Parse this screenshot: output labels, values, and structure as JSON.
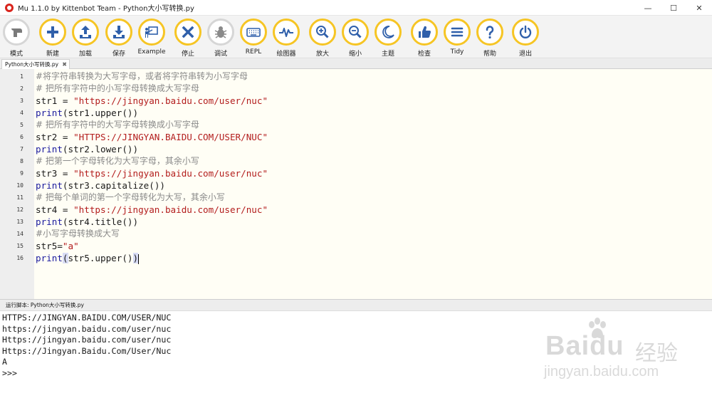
{
  "window": {
    "title": "Mu 1.1.0 by Kittenbot Team - Python大小写转换.py",
    "controls": {
      "minimize": "—",
      "maximize": "☐",
      "close": "✕"
    }
  },
  "toolbar": {
    "buttons": [
      {
        "label": "模式",
        "icon": "mode-icon"
      },
      {
        "label": "新建",
        "icon": "plus-icon"
      },
      {
        "label": "加载",
        "icon": "load-icon"
      },
      {
        "label": "保存",
        "icon": "save-icon"
      },
      {
        "label": "Example",
        "icon": "example-icon"
      },
      {
        "label": "停止",
        "icon": "stop-icon"
      },
      {
        "label": "调试",
        "icon": "bug-icon"
      },
      {
        "label": "REPL",
        "icon": "keyboard-icon"
      },
      {
        "label": "绘图器",
        "icon": "plotter-icon"
      },
      {
        "label": "放大",
        "icon": "zoom-in-icon"
      },
      {
        "label": "缩小",
        "icon": "zoom-out-icon"
      },
      {
        "label": "主题",
        "icon": "moon-icon"
      },
      {
        "label": "检查",
        "icon": "thumbs-up-icon"
      },
      {
        "label": "Tidy",
        "icon": "tidy-icon"
      },
      {
        "label": "帮助",
        "icon": "help-icon"
      },
      {
        "label": "退出",
        "icon": "power-icon"
      }
    ]
  },
  "tab": {
    "label": "Python大小写转换.py",
    "close": "✖"
  },
  "editor": {
    "lines": [
      {
        "n": "1",
        "text": "#将字符串转换为大写字母，或者将字符串转为小写字母"
      },
      {
        "n": "2",
        "text": "# 把所有字符中的小写字母转换成大写字母"
      },
      {
        "n": "3",
        "text": "str1 = \"https://jingyan.baidu.com/user/nuc\""
      },
      {
        "n": "4",
        "text": "print(str1.upper())"
      },
      {
        "n": "5",
        "text": "# 把所有字符中的大写字母转换成小写字母"
      },
      {
        "n": "6",
        "text": "str2 = \"HTTPS://JINGYAN.BAIDU.COM/USER/NUC\""
      },
      {
        "n": "7",
        "text": "print(str2.lower())"
      },
      {
        "n": "8",
        "text": "# 把第一个字母转化为大写字母，其余小写"
      },
      {
        "n": "9",
        "text": "str3 = \"https://jingyan.baidu.com/user/nuc\""
      },
      {
        "n": "10",
        "text": "print(str3.capitalize())"
      },
      {
        "n": "11",
        "text": "# 把每个单词的第一个字母转化为大写，其余小写"
      },
      {
        "n": "12",
        "text": "str4 = \"https://jingyan.baidu.com/user/nuc\""
      },
      {
        "n": "13",
        "text": "print(str4.title())"
      },
      {
        "n": "14",
        "text": "#小写字母转换成大写"
      },
      {
        "n": "15",
        "text": "str5=\"a\""
      },
      {
        "n": "16",
        "text": "print(str5.upper())"
      }
    ]
  },
  "run_panel": {
    "header": "运行脚本: Python大小写转换.py",
    "output": [
      "HTTPS://JINGYAN.BAIDU.COM/USER/NUC",
      "https://jingyan.baidu.com/user/nuc",
      "Https://jingyan.baidu.com/user/nuc",
      "Https://Jingyan.Baidu.Com/User/Nuc",
      "A",
      ">>>"
    ]
  },
  "watermark": {
    "brand": "Baidu",
    "cn": "经验",
    "url": "jingyan.baidu.com"
  },
  "colors": {
    "button_ring": "#f6c524",
    "editor_bg": "#fffef5",
    "keyword": "#1a1a9e",
    "string": "#b31d1d",
    "comment": "#8a8a8a"
  }
}
